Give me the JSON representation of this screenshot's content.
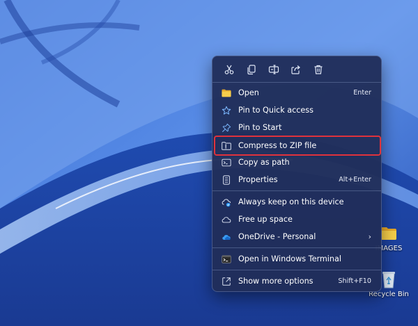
{
  "toolbar": {
    "actions": [
      {
        "name": "cut",
        "icon": "scissors-icon"
      },
      {
        "name": "copy",
        "icon": "copy-icon"
      },
      {
        "name": "rename",
        "icon": "rename-icon"
      },
      {
        "name": "share",
        "icon": "share-icon"
      },
      {
        "name": "delete",
        "icon": "trash-icon"
      }
    ]
  },
  "menu": {
    "open": {
      "label": "Open",
      "shortcut": "Enter",
      "icon": "folder-icon"
    },
    "pin_quick_access": {
      "label": "Pin to Quick access",
      "icon": "star-icon"
    },
    "pin_start": {
      "label": "Pin to Start",
      "icon": "pin-icon"
    },
    "compress_zip": {
      "label": "Compress to ZIP file",
      "icon": "zip-folder-icon",
      "highlighted": true
    },
    "copy_path": {
      "label": "Copy as path",
      "icon": "path-icon"
    },
    "properties": {
      "label": "Properties",
      "shortcut": "Alt+Enter",
      "icon": "properties-icon"
    },
    "always_keep": {
      "label": "Always keep on this device",
      "icon": "cloud-check-icon"
    },
    "free_up": {
      "label": "Free up space",
      "icon": "cloud-icon"
    },
    "onedrive": {
      "label": "OneDrive - Personal",
      "icon": "onedrive-icon",
      "has_submenu": true
    },
    "terminal": {
      "label": "Open in Windows Terminal",
      "icon": "terminal-icon"
    },
    "more_options": {
      "label": "Show more options",
      "shortcut": "Shift+F10",
      "icon": "expand-icon"
    }
  },
  "desktop": {
    "images_label": "IMAGES",
    "recycle_label": "Recycle Bin"
  },
  "colors": {
    "menu_bg": "#202e5a",
    "highlight_border": "#e0323c",
    "folder_yellow": "#f3c531",
    "accent_blue": "#6fb2ff"
  }
}
